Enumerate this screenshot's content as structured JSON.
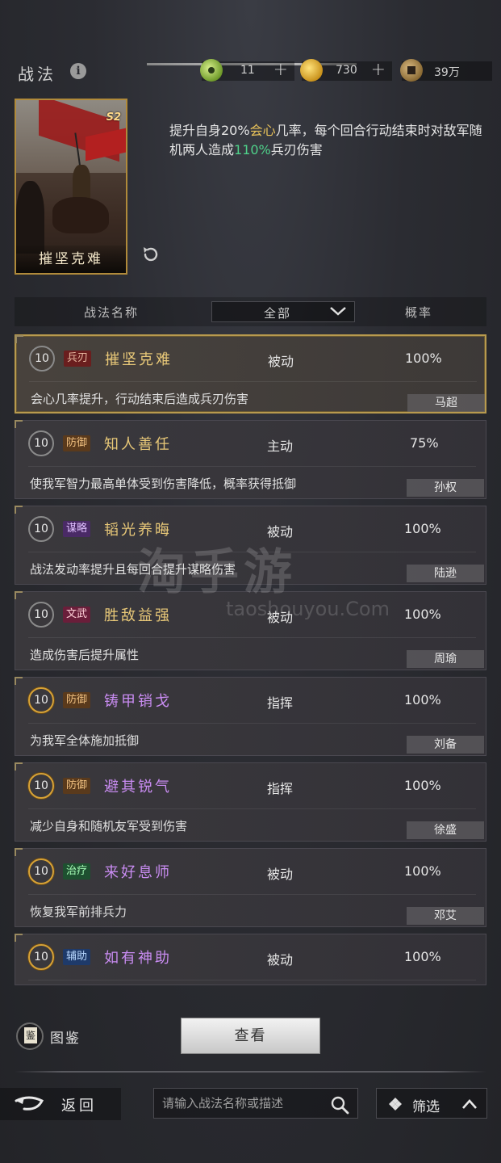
{
  "header": {
    "title": "战法",
    "info_icon": "i",
    "resources": [
      {
        "icon": "jade-icon",
        "value": "11",
        "plus": "+"
      },
      {
        "icon": "gold-coin-icon",
        "value": "730",
        "plus": "+"
      },
      {
        "icon": "copper-coin-icon",
        "value": "39万"
      }
    ]
  },
  "selected_skill": {
    "card_name": "摧坚克难",
    "card_tag": "S2",
    "desc_parts": [
      "提升自身20%",
      "会心",
      "几率，每个回合行动结束时对敌军随机两人造成",
      "110%",
      "兵刃伤害"
    ]
  },
  "table_header": {
    "name_col": "战法名称",
    "filter_value": "全部",
    "rate_col": "概率"
  },
  "skills": [
    {
      "level": "10",
      "type": "兵刃",
      "name": "摧坚克难",
      "mode": "被动",
      "rate": "100%",
      "effect": "会心几率提升，行动结束后造成兵刃伤害",
      "hero": "马超"
    },
    {
      "level": "10",
      "type": "防御",
      "name": "知人善任",
      "mode": "主动",
      "rate": "75%",
      "effect": "使我军智力最高单体受到伤害降低，概率获得抵御",
      "hero": "孙权"
    },
    {
      "level": "10",
      "type": "谋略",
      "name": "韬光养晦",
      "mode": "被动",
      "rate": "100%",
      "effect": "战法发动率提升且每回合提升谋略伤害",
      "hero": "陆逊"
    },
    {
      "level": "10",
      "type": "文武",
      "name": "胜敌益强",
      "mode": "被动",
      "rate": "100%",
      "effect": "造成伤害后提升属性",
      "hero": "周瑜"
    },
    {
      "level": "10",
      "type": "防御",
      "name": "铸甲销戈",
      "mode": "指挥",
      "rate": "100%",
      "effect": "为我军全体施加抵御",
      "hero": "刘备"
    },
    {
      "level": "10",
      "type": "防御",
      "name": "避其锐气",
      "mode": "指挥",
      "rate": "100%",
      "effect": "减少自身和随机友军受到伤害",
      "hero": "徐盛"
    },
    {
      "level": "10",
      "type": "治疗",
      "name": "来好息师",
      "mode": "被动",
      "rate": "100%",
      "effect": "恢复我军前排兵力",
      "hero": "邓艾"
    },
    {
      "level": "10",
      "type": "辅助",
      "name": "如有神助",
      "mode": "被动",
      "rate": "100%",
      "effect": "",
      "hero": ""
    }
  ],
  "footer": {
    "handbook_label": "图鉴",
    "view_button": "查看",
    "back_label": "返回",
    "search_placeholder": "请输入战法名称或描述",
    "filter_label": "筛选"
  },
  "watermark": {
    "cn": "淘手游",
    "en": "taoshouyou.Com"
  }
}
